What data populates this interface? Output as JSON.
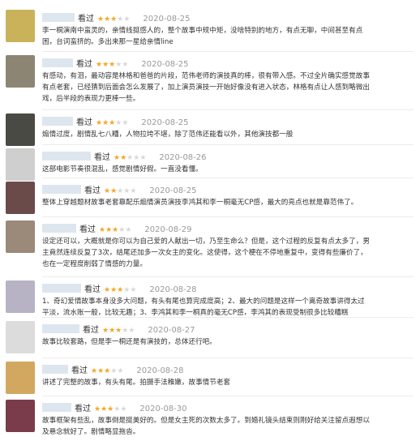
{
  "labels": {
    "seen": "看过"
  },
  "colors": {
    "star": "#f5a623",
    "star_off": "#d8d8d8",
    "date": "#999999",
    "text": "#333333"
  },
  "reviews": [
    {
      "stars": 3,
      "date": "2020-08-25",
      "avatar": "#c9b25a",
      "lines": [
        "李一桐演南中蛮灵的，亲情线挺感人的，整个故事中规中矩，没啥特别的地方，有点无聊，中间甚至有点",
        "困，台词蛮挤的。多出来那一星给亲情line"
      ]
    },
    {
      "stars": 3,
      "date": "2020-08-25",
      "avatar": "#8d8573",
      "lines": [
        "有感动，有泪，最动容是林格和爸爸的片段，范伟老师的演技真的棒，很有带入感。不过全片确实感觉故事",
        "有点老套，已经猜到后面会怎么发展了，加上演员演技一开始好像没有进入状态，林格有点让人感到略微出",
        "戏，后半段的表现力更棒一些。"
      ]
    },
    {
      "stars": 3,
      "date": "2020-08-25",
      "avatar": "#4a4a44",
      "lines": [
        "煽情过度，剧情乱七八糟，人物拉垮不堪，除了范伟还能看以外，其他演技都一般"
      ]
    },
    {
      "stars": 2,
      "date": "2020-08-26",
      "avatar": "#cfcfcf",
      "lines": [
        "这部电影节奏很混乱，感觉剧情好假。一直没看懂。"
      ]
    },
    {
      "stars": 2,
      "date": "2020-08-25",
      "avatar": "#6b4a4a",
      "lines": [
        "整体上穿越题材故事老套靠配乐煽情演员演技李鸿其和李一桐毫无CP感，最大的亮点也就是靠范伟了。"
      ]
    },
    {
      "stars": 3,
      "date": "2020-08-29",
      "avatar": "#9b8a7a",
      "lines": [
        "设定还可以，大概就是你可以为自己爱的人献出一切，乃至生命么？但是，这个过程的反复有点太多了，男",
        "主竟然连续反复了3次，结尾还加多一次女主的变化。这使得，这个梗在不停地重复中，变得有些廉价了，",
        "也在一定程度削弱了情感的力量。"
      ]
    },
    {
      "stars": 3,
      "date": "2020-08-28",
      "avatar": "#b7b2c4",
      "lines": [
        "1、奇幻爱情故事本身没多大问题，有头有尾也算完成度高；2、最大的问题是这样一个离奇故事讲得太过",
        "平淡，流水账一般，比较无趣；3、李鸿其和李一桐真的毫无CP感，李鸿其的表现受制很多比较糟糕"
      ]
    },
    {
      "stars": 3,
      "date": "2020-08-27",
      "avatar": "#dcdcdc",
      "lines": [
        "故事比较套路，但是李一桐还是有演技的，总体还行吧。"
      ]
    },
    {
      "stars": 3,
      "date": "2020-08-28",
      "avatar": "#d2a860",
      "lines": [
        "讲述了完整的故事，有头有尾。拍摄手法稚嫩，故事情节老套"
      ]
    },
    {
      "stars": 3,
      "date": "2020-08-30",
      "avatar": "#7a3c4a",
      "lines": [
        "故事框架有些乱，故事倒是挺美好的。但是女主死的次数太多了。到婚礼镜头结束则刚好给关注留点遐想以",
        "及悬念就好了。剧情略显拖沓。"
      ]
    }
  ]
}
